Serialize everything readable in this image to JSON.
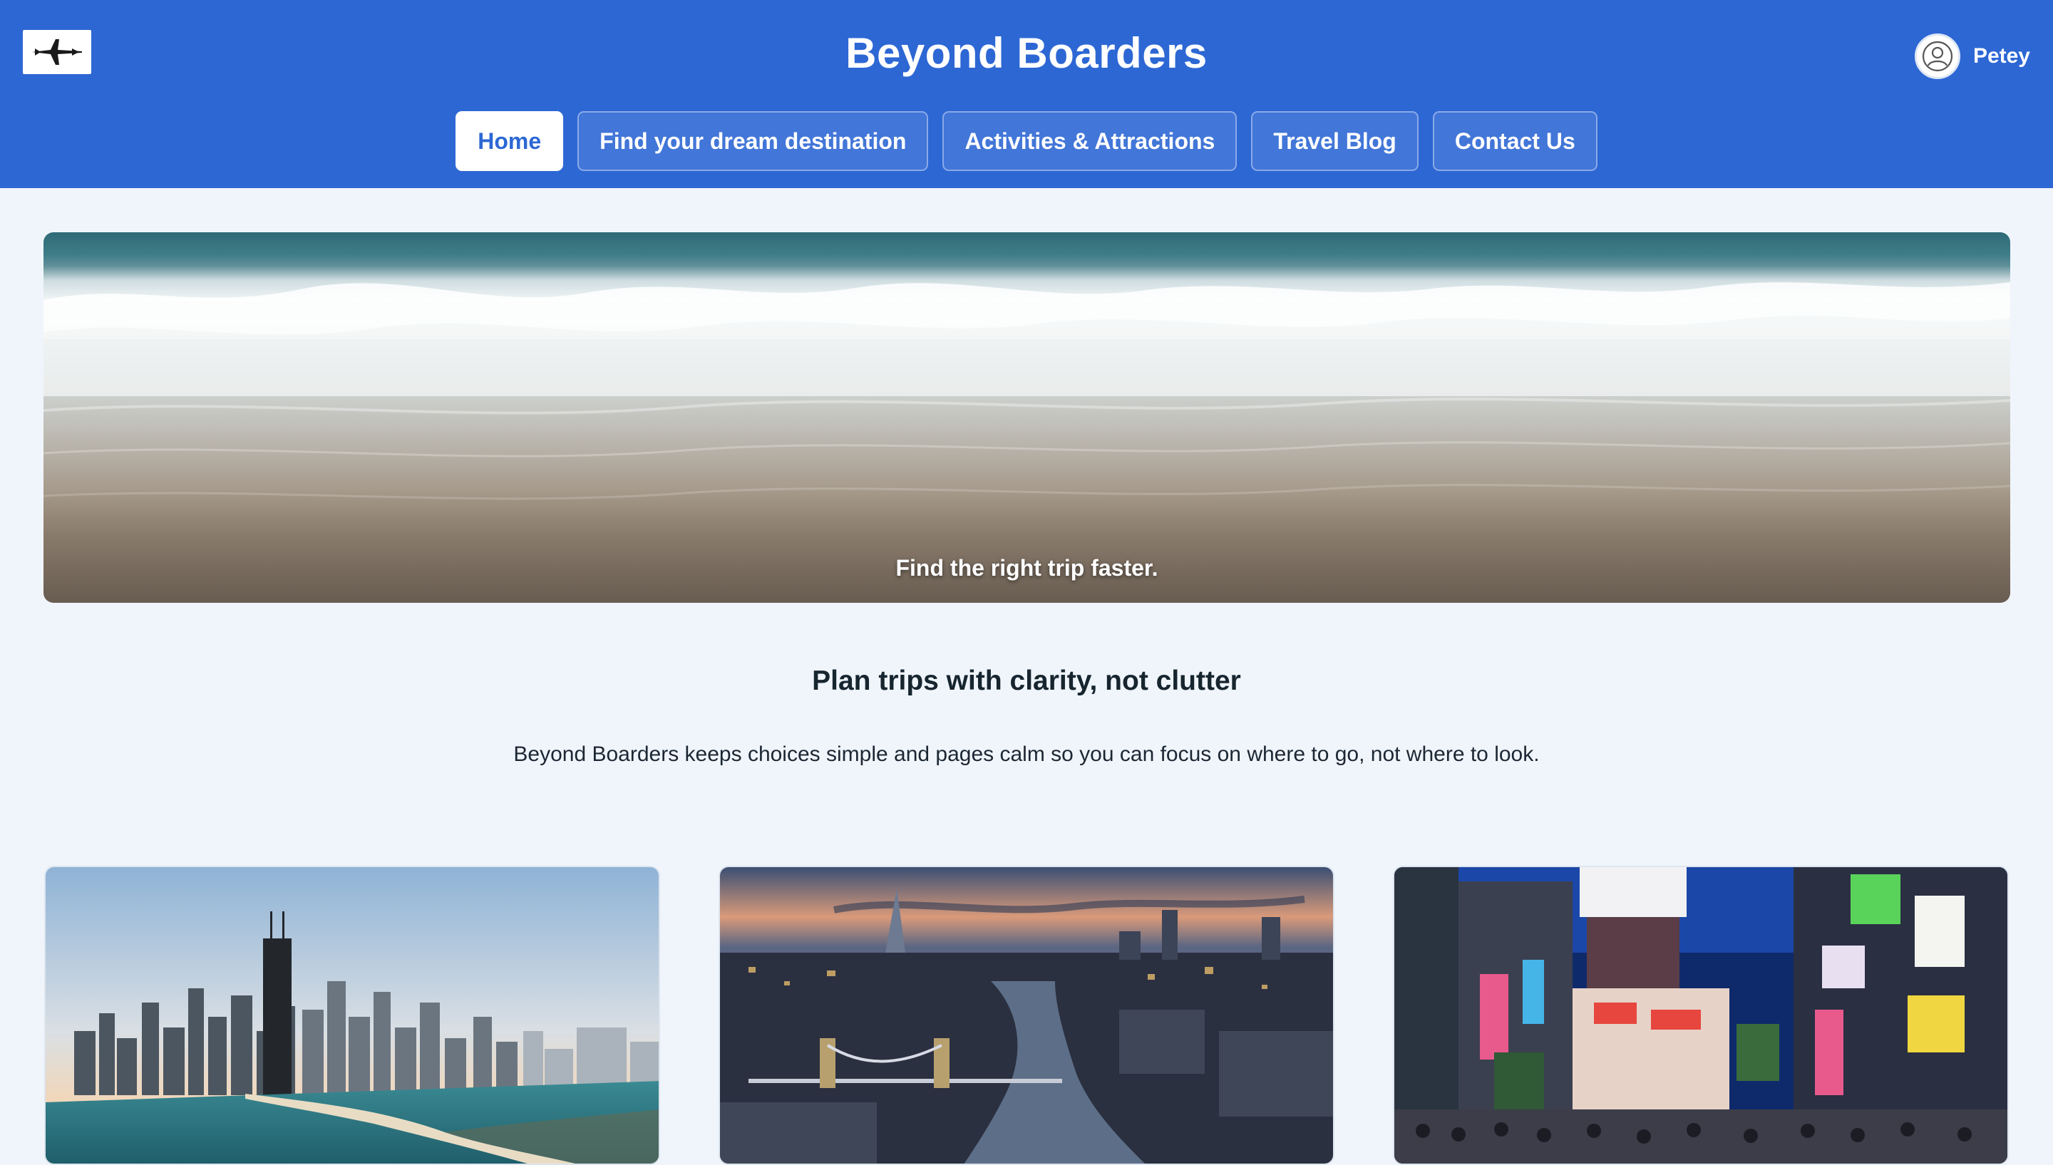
{
  "header": {
    "logo_icon": "airplane-icon",
    "site_title": "Beyond Boarders",
    "user": {
      "avatar_icon": "user-circle-icon",
      "name": "Petey"
    }
  },
  "nav": {
    "items": [
      {
        "label": "Home",
        "active": true
      },
      {
        "label": "Find your dream destination",
        "active": false
      },
      {
        "label": "Activities & Attractions",
        "active": false
      },
      {
        "label": "Travel Blog",
        "active": false
      },
      {
        "label": "Contact Us",
        "active": false
      }
    ]
  },
  "hero": {
    "caption": "Find the right trip faster."
  },
  "intro": {
    "title": "Plan trips with clarity, not clutter",
    "text": "Beyond Boarders keeps choices simple and pages calm so you can focus on where to go, not where to look."
  },
  "colors": {
    "brand_blue": "#2d67d4",
    "page_background": "#f0f5fc",
    "text_dark": "#17252f"
  }
}
